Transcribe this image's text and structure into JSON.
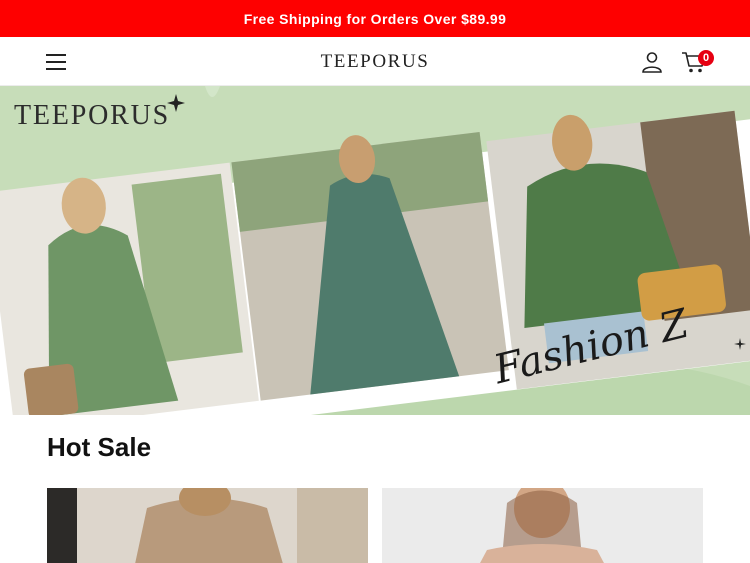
{
  "announcement": {
    "text": "Free Shipping for Orders Over $89.99"
  },
  "header": {
    "logo": "TEEPORUS",
    "cart_count": "0",
    "icons": [
      "hamburger-menu-icon",
      "user-icon",
      "cart-icon"
    ]
  },
  "banner": {
    "brand": "TEEPORUS",
    "script_text": "Fashion Z"
  },
  "hot_sale": {
    "title": "Hot Sale"
  },
  "colors": {
    "announcement_bg": "#fe0000",
    "cart_badge": "#e60012",
    "banner_green": "#cfe3c4"
  }
}
